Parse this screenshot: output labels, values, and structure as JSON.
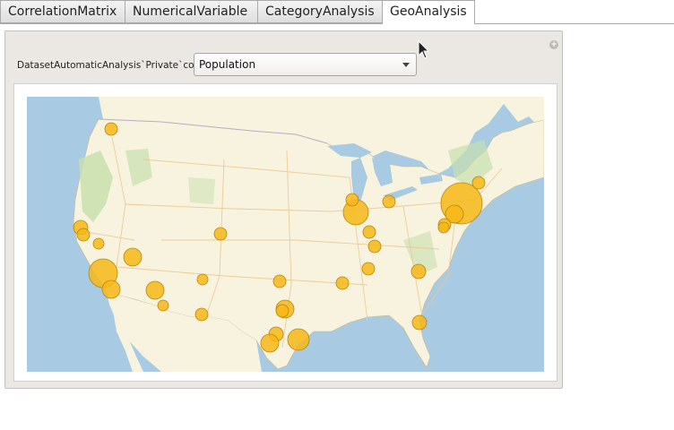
{
  "tabs": [
    {
      "label": "CorrelationMatrix",
      "active": false
    },
    {
      "label": "NumericalVariable",
      "active": false
    },
    {
      "label": "CategoryAnalysis",
      "active": false
    },
    {
      "label": "GeoAnalysis",
      "active": true
    }
  ],
  "panel": {
    "control_label": "DatasetAutomaticAnalysis`Private`col",
    "selected_variable": "Population",
    "add_icon": "plus-circle-icon"
  },
  "map": {
    "region": "United States",
    "bubble_color": "#f7b718",
    "water_color": "#a8cbe3",
    "land_color": "#f8f3de"
  }
}
